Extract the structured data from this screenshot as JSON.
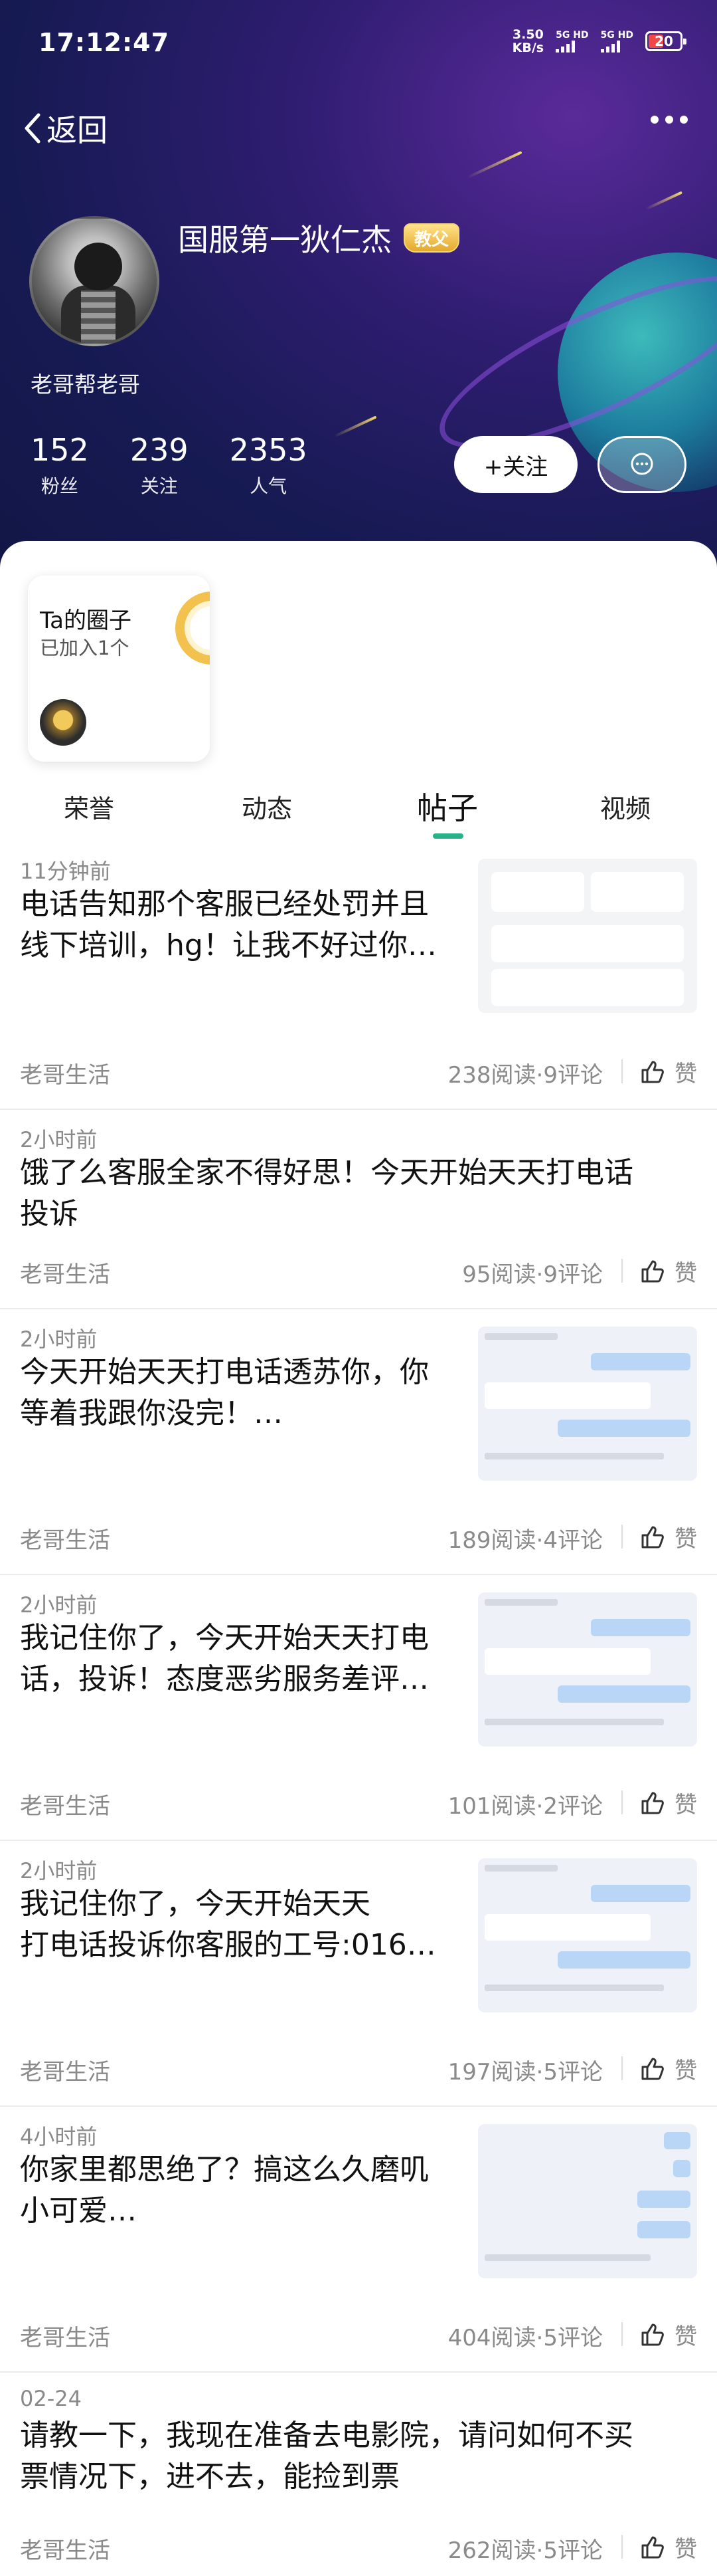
{
  "status_bar": {
    "time": "17:12:47",
    "speed_top": "3.50",
    "speed_unit": "KB/s",
    "sim1": "5G HD",
    "sim2": "5G HD",
    "battery": "20"
  },
  "nav": {
    "back_label": "返回"
  },
  "profile": {
    "name": "国服第一狄仁杰",
    "badge": "教父",
    "bio": "老哥帮老哥",
    "stats": [
      {
        "value": "152",
        "label": "粉丝"
      },
      {
        "value": "239",
        "label": "关注"
      },
      {
        "value": "2353",
        "label": "人气"
      }
    ],
    "follow_label": "+关注"
  },
  "circle_card": {
    "title": "Ta的圈子",
    "subtitle": "已加入1个"
  },
  "tabs": [
    "荣誉",
    "动态",
    "帖子",
    "视频"
  ],
  "active_tab": "帖子",
  "posts": [
    {
      "time": "11分钟前",
      "title_lines": [
        "电话告知那个客服已经处罚并且",
        "线下培训，hg！让我不好过你…"
      ],
      "author": "老哥生活",
      "meta": "238阅读·9评论",
      "like": "赞",
      "thumb": "call"
    },
    {
      "time": "2小时前",
      "title_lines": [
        "饿了么客服全家不得好思！今天开始天天打电话",
        "投诉"
      ],
      "author": "老哥生活",
      "meta": "95阅读·9评论",
      "like": "赞",
      "thumb": "none"
    },
    {
      "time": "2小时前",
      "title_lines": [
        "今天开始天天打电话透苏你，你",
        "等着我跟你没完！…"
      ],
      "author": "老哥生活",
      "meta": "189阅读·4评论",
      "like": "赞",
      "thumb": "chat"
    },
    {
      "time": "2小时前",
      "title_lines": [
        "我记住你了，今天开始天天打电",
        "话，投诉！态度恶劣服务差评…"
      ],
      "author": "老哥生活",
      "meta": "101阅读·2评论",
      "like": "赞",
      "thumb": "chat"
    },
    {
      "time": "2小时前",
      "title_lines": [
        "我记住你了，今天开始天天",
        "打电话投诉你客服的工号:016…"
      ],
      "author": "老哥生活",
      "meta": "197阅读·5评论",
      "like": "赞",
      "thumb": "chat"
    },
    {
      "time": "4小时前",
      "title_lines": [
        "你家里都思绝了？搞这么久磨叽",
        "小可爱…"
      ],
      "author": "老哥生活",
      "meta": "404阅读·5评论",
      "like": "赞",
      "thumb": "chat2"
    },
    {
      "time": "02-24",
      "title_lines": [
        "请教一下，我现在准备去电影院，请问如何不买",
        "票情况下，进不去，能捡到票"
      ],
      "author": "老哥生活",
      "meta": "262阅读·5评论",
      "like": "赞",
      "thumb": "none"
    }
  ]
}
